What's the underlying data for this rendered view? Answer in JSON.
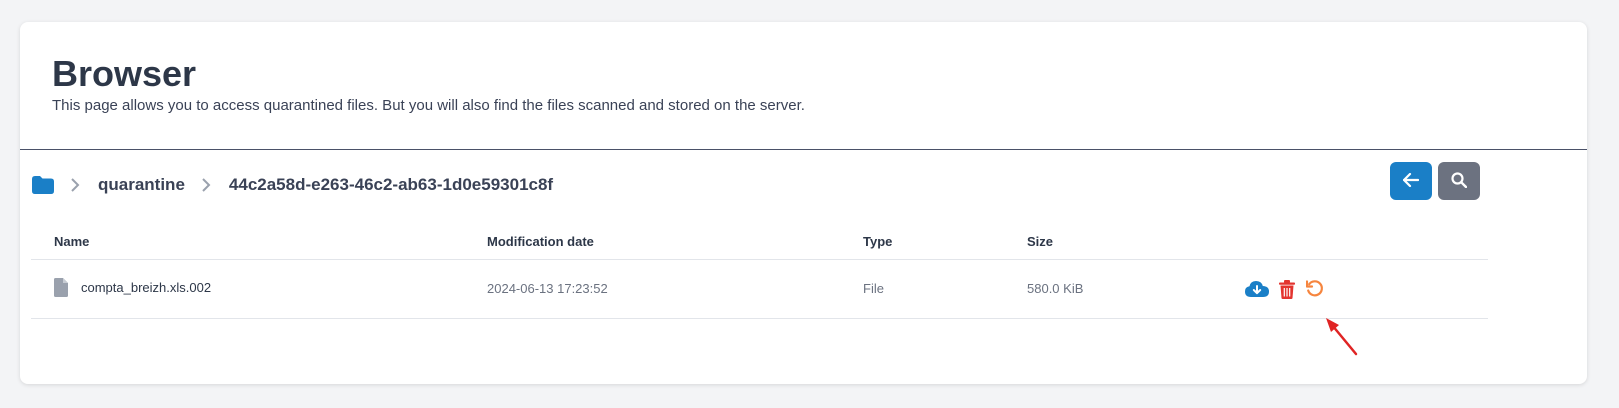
{
  "header": {
    "title": "Browser",
    "subtitle": "This page allows you to access quarantined files. But you will also find the files scanned and stored on the server."
  },
  "breadcrumb": {
    "root_icon": "folder-icon",
    "items": [
      "quarantine",
      "44c2a58d-e263-46c2-ab63-1d0e59301c8f"
    ]
  },
  "toolbar": {
    "back_icon": "arrow-left-icon",
    "search_icon": "search-icon"
  },
  "table": {
    "columns": [
      "Name",
      "Modification date",
      "Type",
      "Size"
    ],
    "rows": [
      {
        "name": "compta_breizh.xls.002",
        "modified": "2024-06-13 17:23:52",
        "type": "File",
        "size": "580.0 KiB",
        "actions": [
          "cloud-download-icon",
          "trash-icon",
          "restore-icon"
        ]
      }
    ]
  },
  "colors": {
    "primary": "#1a7fc7",
    "secondary": "#6c7280",
    "danger": "#e3342f",
    "warning": "#f6853e",
    "annotation": "#e02424"
  }
}
